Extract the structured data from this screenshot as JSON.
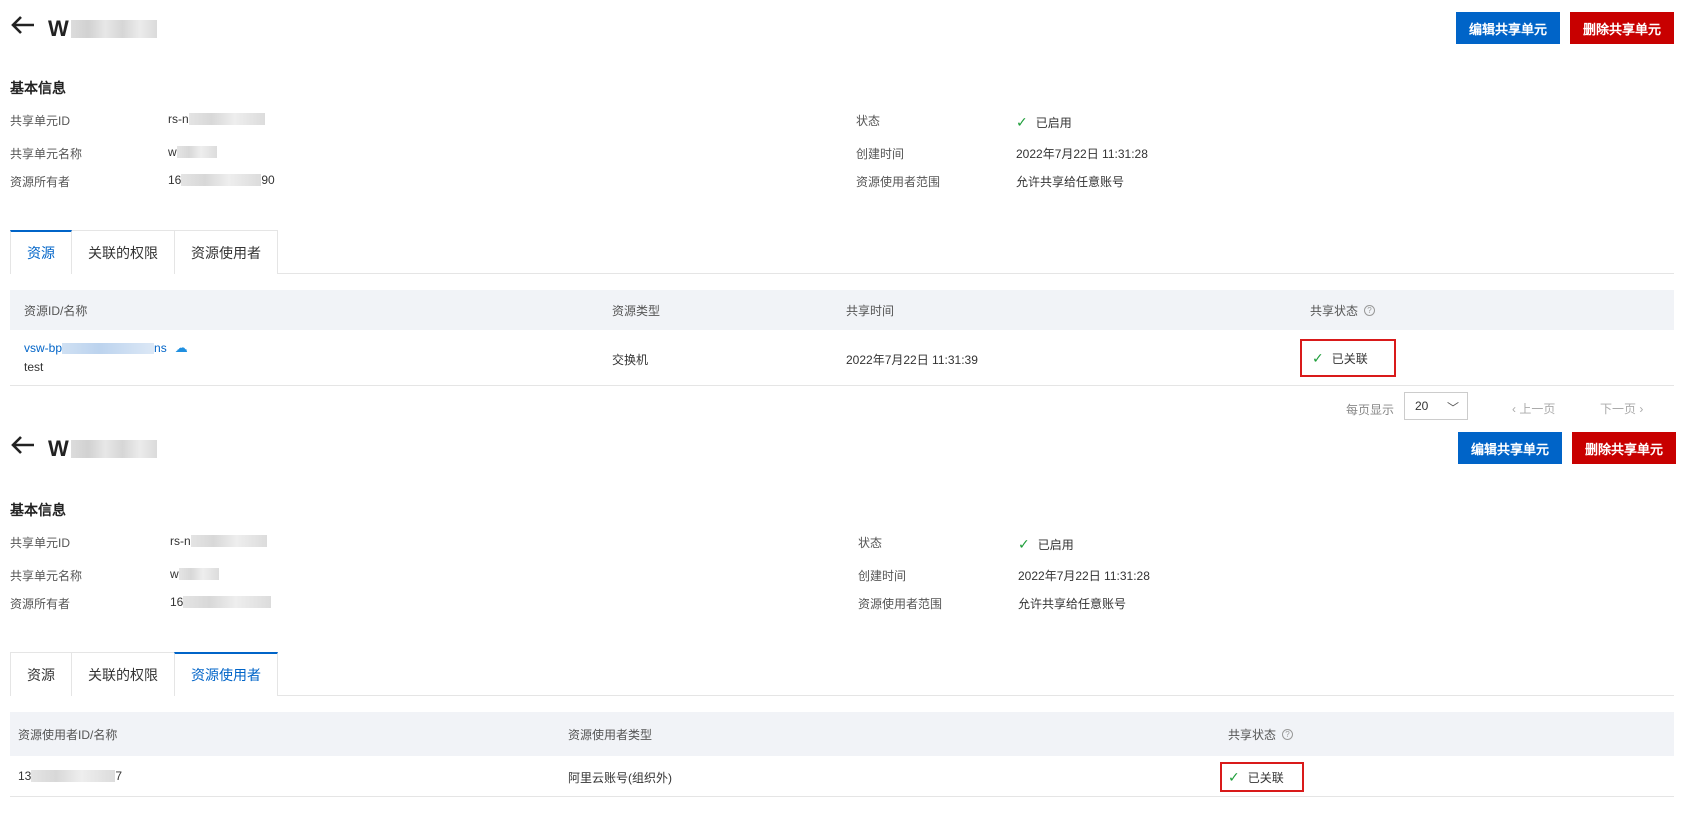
{
  "top": {
    "title_prefix": "W",
    "buttons": {
      "edit": "编辑共享单元",
      "delete": "删除共享单元"
    },
    "section_title": "基本信息",
    "info": {
      "id_label": "共享单元ID",
      "id_value": "rs-n",
      "name_label": "共享单元名称",
      "name_value": "w",
      "owner_label": "资源所有者",
      "owner_value_prefix": "16",
      "owner_value_suffix": "90",
      "status_label": "状态",
      "status_value": "已启用",
      "created_label": "创建时间",
      "created_value": "2022年7月22日 11:31:28",
      "scope_label": "资源使用者范围",
      "scope_value": "允许共享给任意账号"
    },
    "tabs": [
      "资源",
      "关联的权限",
      "资源使用者"
    ],
    "table": {
      "headers": [
        "资源ID/名称",
        "资源类型",
        "共享时间",
        "共享状态"
      ],
      "row": {
        "id_prefix": "vsw-bp",
        "id_suffix": "ns",
        "name": "test",
        "type": "交换机",
        "time": "2022年7月22日 11:31:39",
        "status": "已关联"
      }
    },
    "pager": {
      "label": "每页显示",
      "size": "20",
      "prev": "上一页",
      "next": "下一页"
    }
  },
  "bottom": {
    "title_prefix": "W",
    "buttons": {
      "edit": "编辑共享单元",
      "delete": "删除共享单元"
    },
    "section_title": "基本信息",
    "info": {
      "id_label": "共享单元ID",
      "id_value": "rs-n",
      "name_label": "共享单元名称",
      "name_value": "w",
      "owner_label": "资源所有者",
      "owner_value_prefix": "16",
      "status_label": "状态",
      "status_value": "已启用",
      "created_label": "创建时间",
      "created_value": "2022年7月22日 11:31:28",
      "scope_label": "资源使用者范围",
      "scope_value": "允许共享给任意账号"
    },
    "tabs": [
      "资源",
      "关联的权限",
      "资源使用者"
    ],
    "table": {
      "headers": [
        "资源使用者ID/名称",
        "资源使用者类型",
        "共享状态"
      ],
      "row": {
        "id_prefix": "13",
        "id_suffix": "7",
        "type": "阿里云账号(组织外)",
        "status": "已关联"
      }
    }
  },
  "colors": {
    "primary": "#0064c8",
    "danger": "#c80000",
    "success": "#1e9e3a",
    "highlight": "#d91a1a"
  },
  "icons": {
    "back": "arrow-left-icon",
    "check": "check-icon",
    "help": "question-circle-icon",
    "cloud": "cloud-icon",
    "chevron": "chevron-down-icon"
  }
}
